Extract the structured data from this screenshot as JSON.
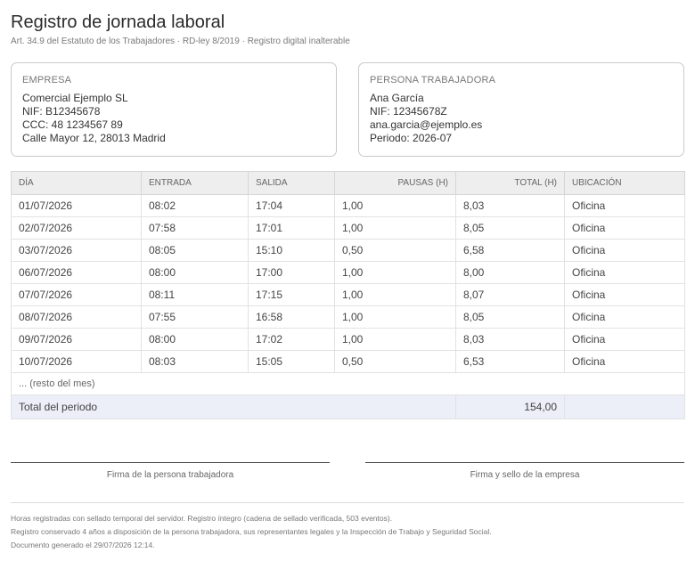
{
  "header": {
    "title": "Registro de jornada laboral",
    "subtitle": "Art. 34.9 del Estatuto de los Trabajadores · RD-ley 8/2019 · Registro digital inalterable"
  },
  "empresa": {
    "label": "EMPRESA",
    "lines": [
      "Comercial Ejemplo SL",
      "NIF: B12345678",
      "CCC: 48 1234567 89",
      "Calle Mayor 12, 28013 Madrid"
    ]
  },
  "trabajador": {
    "label": "PERSONA TRABAJADORA",
    "lines": [
      "Ana García",
      "NIF: 12345678Z",
      "ana.garcia@ejemplo.es",
      "Periodo: 2026-07"
    ]
  },
  "table": {
    "headers": [
      "DÍA",
      "ENTRADA",
      "SALIDA",
      "PAUSAS (H)",
      "TOTAL (H)",
      "UBICACIÓN"
    ],
    "rows": [
      [
        "01/07/2026",
        "08:02",
        "17:04",
        "1,00",
        "8,03",
        "Oficina"
      ],
      [
        "02/07/2026",
        "07:58",
        "17:01",
        "1,00",
        "8,05",
        "Oficina"
      ],
      [
        "03/07/2026",
        "08:05",
        "15:10",
        "0,50",
        "6,58",
        "Oficina"
      ],
      [
        "06/07/2026",
        "08:00",
        "17:00",
        "1,00",
        "8,00",
        "Oficina"
      ],
      [
        "07/07/2026",
        "08:11",
        "17:15",
        "1,00",
        "8,07",
        "Oficina"
      ],
      [
        "08/07/2026",
        "07:55",
        "16:58",
        "1,00",
        "8,05",
        "Oficina"
      ],
      [
        "09/07/2026",
        "08:00",
        "17:02",
        "1,00",
        "8,03",
        "Oficina"
      ],
      [
        "10/07/2026",
        "08:03",
        "15:05",
        "0,50",
        "6,53",
        "Oficina"
      ]
    ],
    "note": "... (resto del mes)",
    "total_label": "Total del periodo",
    "total_value": "154,00"
  },
  "signatures": {
    "worker": "Firma de la persona trabajadora",
    "company": "Firma y sello de la empresa"
  },
  "footer": {
    "lines": [
      "Horas registradas con sellado temporal del servidor. Registro íntegro (cadena de sellado verificada, 503 eventos).",
      "Registro conservado 4 años a disposición de la persona trabajadora, sus representantes legales y la Inspección de Trabajo y Seguridad Social.",
      "Documento generado el 29/07/2026 12:14."
    ]
  }
}
